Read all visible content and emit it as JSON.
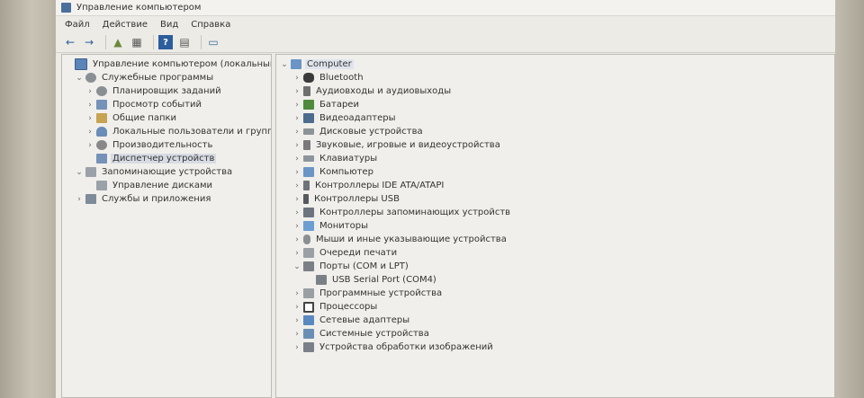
{
  "window": {
    "title": "Управление компьютером"
  },
  "menu": [
    {
      "id": "file",
      "label": "Файл"
    },
    {
      "id": "action",
      "label": "Действие"
    },
    {
      "id": "view",
      "label": "Вид"
    },
    {
      "id": "help",
      "label": "Справка"
    }
  ],
  "toolbar": {
    "back": "←",
    "forward": "→",
    "up": "▲",
    "panel": "▦",
    "help": "?",
    "properties": "▤",
    "computer": "▭"
  },
  "left_tree": [
    {
      "name": "tree-root",
      "icon": "monitor",
      "label": "Управление компьютером (локальным)",
      "depth": 0,
      "caret": ""
    },
    {
      "name": "tree-system-tools",
      "icon": "gear",
      "label": "Служебные программы",
      "depth": 1,
      "caret": "⌄"
    },
    {
      "name": "tree-task-scheduler",
      "icon": "gear",
      "label": "Планировщик заданий",
      "depth": 2,
      "caret": "›"
    },
    {
      "name": "tree-event-viewer",
      "icon": "device",
      "label": "Просмотр событий",
      "depth": 2,
      "caret": "›"
    },
    {
      "name": "tree-shared-folders",
      "icon": "folder",
      "label": "Общие папки",
      "depth": 2,
      "caret": "›"
    },
    {
      "name": "tree-local-users",
      "icon": "users",
      "label": "Локальные пользователи и группы",
      "depth": 2,
      "caret": "›"
    },
    {
      "name": "tree-performance",
      "icon": "chart",
      "label": "Производительность",
      "depth": 2,
      "caret": "›"
    },
    {
      "name": "tree-device-manager",
      "icon": "device",
      "label": "Диспетчер устройств",
      "depth": 2,
      "caret": "",
      "selected": true
    },
    {
      "name": "tree-storage",
      "icon": "disk",
      "label": "Запоминающие устройства",
      "depth": 1,
      "caret": "⌄"
    },
    {
      "name": "tree-disk-management",
      "icon": "disk",
      "label": "Управление дисками",
      "depth": 2,
      "caret": ""
    },
    {
      "name": "tree-services-apps",
      "icon": "apps",
      "label": "Службы и приложения",
      "depth": 1,
      "caret": "›"
    }
  ],
  "device_tree": [
    {
      "name": "device-root",
      "icon": "pc",
      "label": "Computer",
      "depth": 0,
      "caret": "⌄",
      "selected": true
    },
    {
      "name": "device-bluetooth",
      "icon": "bt",
      "label": "Bluetooth",
      "depth": 1,
      "caret": "›"
    },
    {
      "name": "device-audio-io",
      "icon": "audio",
      "label": "Аудиовходы и аудиовыходы",
      "depth": 1,
      "caret": "›"
    },
    {
      "name": "device-batteries",
      "icon": "battery",
      "label": "Батареи",
      "depth": 1,
      "caret": "›"
    },
    {
      "name": "device-video",
      "icon": "video",
      "label": "Видеоадаптеры",
      "depth": 1,
      "caret": "›"
    },
    {
      "name": "device-disks",
      "icon": "hdd",
      "label": "Дисковые устройства",
      "depth": 1,
      "caret": "›"
    },
    {
      "name": "device-sound",
      "icon": "sound",
      "label": "Звуковые, игровые и видеоустройства",
      "depth": 1,
      "caret": "›"
    },
    {
      "name": "device-keyboards",
      "icon": "kbd",
      "label": "Клавиатуры",
      "depth": 1,
      "caret": "›"
    },
    {
      "name": "device-computer",
      "icon": "pc",
      "label": "Компьютер",
      "depth": 1,
      "caret": "›"
    },
    {
      "name": "device-ide",
      "icon": "ide",
      "label": "Контроллеры IDE ATA/ATAPI",
      "depth": 1,
      "caret": "›"
    },
    {
      "name": "device-usb",
      "icon": "usb",
      "label": "Контроллеры USB",
      "depth": 1,
      "caret": "›"
    },
    {
      "name": "device-storage-ctrl",
      "icon": "storage",
      "label": "Контроллеры запоминающих устройств",
      "depth": 1,
      "caret": "›"
    },
    {
      "name": "device-monitors",
      "icon": "mon",
      "label": "Мониторы",
      "depth": 1,
      "caret": "›"
    },
    {
      "name": "device-mice",
      "icon": "mouse",
      "label": "Мыши и иные указывающие устройства",
      "depth": 1,
      "caret": "›"
    },
    {
      "name": "device-print-queues",
      "icon": "print",
      "label": "Очереди печати",
      "depth": 1,
      "caret": "›"
    },
    {
      "name": "device-ports",
      "icon": "port",
      "label": "Порты (COM и LPT)",
      "depth": 1,
      "caret": "⌄"
    },
    {
      "name": "device-usb-serial",
      "icon": "port",
      "label": "USB Serial Port (COM4)",
      "depth": 2,
      "caret": ""
    },
    {
      "name": "device-software",
      "icon": "prog",
      "label": "Программные устройства",
      "depth": 1,
      "caret": "›"
    },
    {
      "name": "device-processors",
      "icon": "cpu",
      "label": "Процессоры",
      "depth": 1,
      "caret": "›"
    },
    {
      "name": "device-network",
      "icon": "net",
      "label": "Сетевые адаптеры",
      "depth": 1,
      "caret": "›"
    },
    {
      "name": "device-system",
      "icon": "sys",
      "label": "Системные устройства",
      "depth": 1,
      "caret": "›"
    },
    {
      "name": "device-imaging",
      "icon": "img",
      "label": "Устройства обработки изображений",
      "depth": 1,
      "caret": "›"
    }
  ]
}
